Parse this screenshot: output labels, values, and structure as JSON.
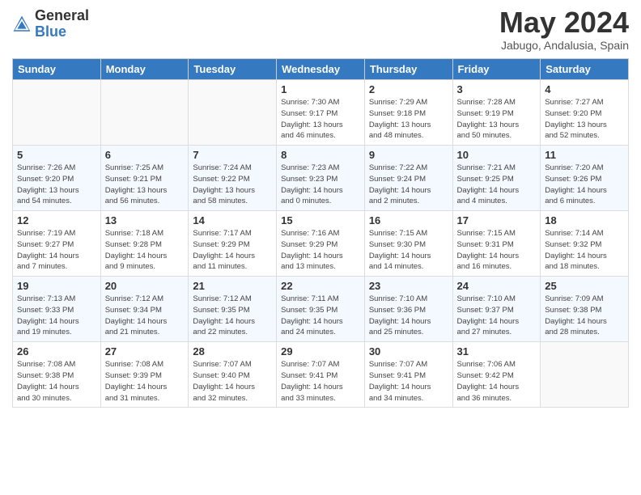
{
  "header": {
    "logo_general": "General",
    "logo_blue": "Blue",
    "month_title": "May 2024",
    "location": "Jabugo, Andalusia, Spain"
  },
  "weekdays": [
    "Sunday",
    "Monday",
    "Tuesday",
    "Wednesday",
    "Thursday",
    "Friday",
    "Saturday"
  ],
  "weeks": [
    [
      {
        "day": "",
        "info": ""
      },
      {
        "day": "",
        "info": ""
      },
      {
        "day": "",
        "info": ""
      },
      {
        "day": "1",
        "info": "Sunrise: 7:30 AM\nSunset: 9:17 PM\nDaylight: 13 hours\nand 46 minutes."
      },
      {
        "day": "2",
        "info": "Sunrise: 7:29 AM\nSunset: 9:18 PM\nDaylight: 13 hours\nand 48 minutes."
      },
      {
        "day": "3",
        "info": "Sunrise: 7:28 AM\nSunset: 9:19 PM\nDaylight: 13 hours\nand 50 minutes."
      },
      {
        "day": "4",
        "info": "Sunrise: 7:27 AM\nSunset: 9:20 PM\nDaylight: 13 hours\nand 52 minutes."
      }
    ],
    [
      {
        "day": "5",
        "info": "Sunrise: 7:26 AM\nSunset: 9:20 PM\nDaylight: 13 hours\nand 54 minutes."
      },
      {
        "day": "6",
        "info": "Sunrise: 7:25 AM\nSunset: 9:21 PM\nDaylight: 13 hours\nand 56 minutes."
      },
      {
        "day": "7",
        "info": "Sunrise: 7:24 AM\nSunset: 9:22 PM\nDaylight: 13 hours\nand 58 minutes."
      },
      {
        "day": "8",
        "info": "Sunrise: 7:23 AM\nSunset: 9:23 PM\nDaylight: 14 hours\nand 0 minutes."
      },
      {
        "day": "9",
        "info": "Sunrise: 7:22 AM\nSunset: 9:24 PM\nDaylight: 14 hours\nand 2 minutes."
      },
      {
        "day": "10",
        "info": "Sunrise: 7:21 AM\nSunset: 9:25 PM\nDaylight: 14 hours\nand 4 minutes."
      },
      {
        "day": "11",
        "info": "Sunrise: 7:20 AM\nSunset: 9:26 PM\nDaylight: 14 hours\nand 6 minutes."
      }
    ],
    [
      {
        "day": "12",
        "info": "Sunrise: 7:19 AM\nSunset: 9:27 PM\nDaylight: 14 hours\nand 7 minutes."
      },
      {
        "day": "13",
        "info": "Sunrise: 7:18 AM\nSunset: 9:28 PM\nDaylight: 14 hours\nand 9 minutes."
      },
      {
        "day": "14",
        "info": "Sunrise: 7:17 AM\nSunset: 9:29 PM\nDaylight: 14 hours\nand 11 minutes."
      },
      {
        "day": "15",
        "info": "Sunrise: 7:16 AM\nSunset: 9:29 PM\nDaylight: 14 hours\nand 13 minutes."
      },
      {
        "day": "16",
        "info": "Sunrise: 7:15 AM\nSunset: 9:30 PM\nDaylight: 14 hours\nand 14 minutes."
      },
      {
        "day": "17",
        "info": "Sunrise: 7:15 AM\nSunset: 9:31 PM\nDaylight: 14 hours\nand 16 minutes."
      },
      {
        "day": "18",
        "info": "Sunrise: 7:14 AM\nSunset: 9:32 PM\nDaylight: 14 hours\nand 18 minutes."
      }
    ],
    [
      {
        "day": "19",
        "info": "Sunrise: 7:13 AM\nSunset: 9:33 PM\nDaylight: 14 hours\nand 19 minutes."
      },
      {
        "day": "20",
        "info": "Sunrise: 7:12 AM\nSunset: 9:34 PM\nDaylight: 14 hours\nand 21 minutes."
      },
      {
        "day": "21",
        "info": "Sunrise: 7:12 AM\nSunset: 9:35 PM\nDaylight: 14 hours\nand 22 minutes."
      },
      {
        "day": "22",
        "info": "Sunrise: 7:11 AM\nSunset: 9:35 PM\nDaylight: 14 hours\nand 24 minutes."
      },
      {
        "day": "23",
        "info": "Sunrise: 7:10 AM\nSunset: 9:36 PM\nDaylight: 14 hours\nand 25 minutes."
      },
      {
        "day": "24",
        "info": "Sunrise: 7:10 AM\nSunset: 9:37 PM\nDaylight: 14 hours\nand 27 minutes."
      },
      {
        "day": "25",
        "info": "Sunrise: 7:09 AM\nSunset: 9:38 PM\nDaylight: 14 hours\nand 28 minutes."
      }
    ],
    [
      {
        "day": "26",
        "info": "Sunrise: 7:08 AM\nSunset: 9:38 PM\nDaylight: 14 hours\nand 30 minutes."
      },
      {
        "day": "27",
        "info": "Sunrise: 7:08 AM\nSunset: 9:39 PM\nDaylight: 14 hours\nand 31 minutes."
      },
      {
        "day": "28",
        "info": "Sunrise: 7:07 AM\nSunset: 9:40 PM\nDaylight: 14 hours\nand 32 minutes."
      },
      {
        "day": "29",
        "info": "Sunrise: 7:07 AM\nSunset: 9:41 PM\nDaylight: 14 hours\nand 33 minutes."
      },
      {
        "day": "30",
        "info": "Sunrise: 7:07 AM\nSunset: 9:41 PM\nDaylight: 14 hours\nand 34 minutes."
      },
      {
        "day": "31",
        "info": "Sunrise: 7:06 AM\nSunset: 9:42 PM\nDaylight: 14 hours\nand 36 minutes."
      },
      {
        "day": "",
        "info": ""
      }
    ]
  ]
}
